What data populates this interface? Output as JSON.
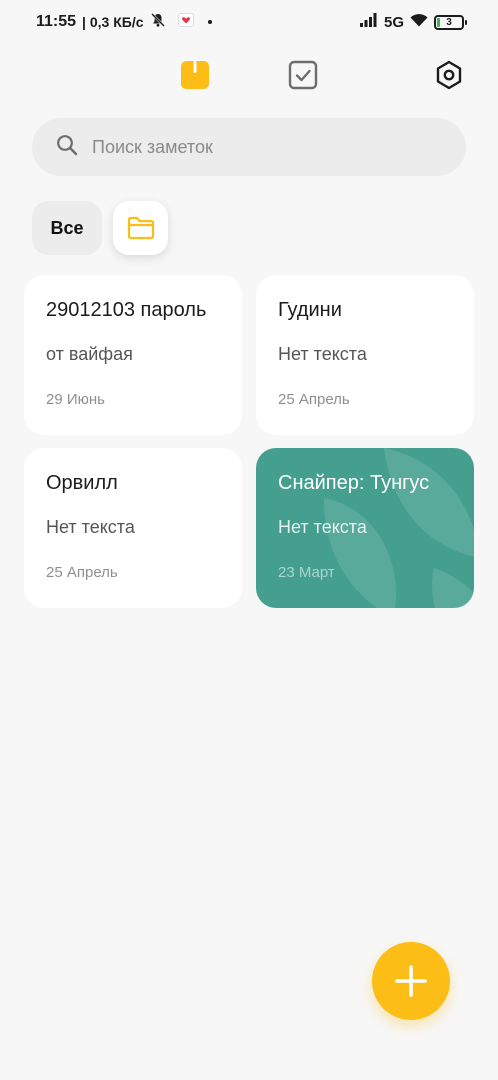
{
  "status_bar": {
    "time": "11:55",
    "network_speed": "| 0,3 КБ/с",
    "network_type": "5G",
    "battery_level": "3"
  },
  "top_bar": {
    "icons": [
      "notes-icon",
      "tasks-icon",
      "settings-icon"
    ],
    "active_tab": "notes"
  },
  "search": {
    "placeholder": "Поиск заметок",
    "value": ""
  },
  "filters": {
    "all_label": "Все"
  },
  "notes": [
    {
      "title": "29012103 пароль",
      "body": "от вайфая",
      "date": "29 Июнь"
    },
    {
      "title": "Гудини",
      "body": "Нет текста",
      "date": "25 Апрель"
    },
    {
      "title": "Орвилл",
      "body": "Нет текста",
      "date": "25 Апрель"
    },
    {
      "title": "Снайпер: Тунгус",
      "body": "Нет текста",
      "date": "23 Март"
    }
  ],
  "colors": {
    "accent": "#fbbd16",
    "teal_note": "#449f8f",
    "background": "#f7f7f7"
  }
}
